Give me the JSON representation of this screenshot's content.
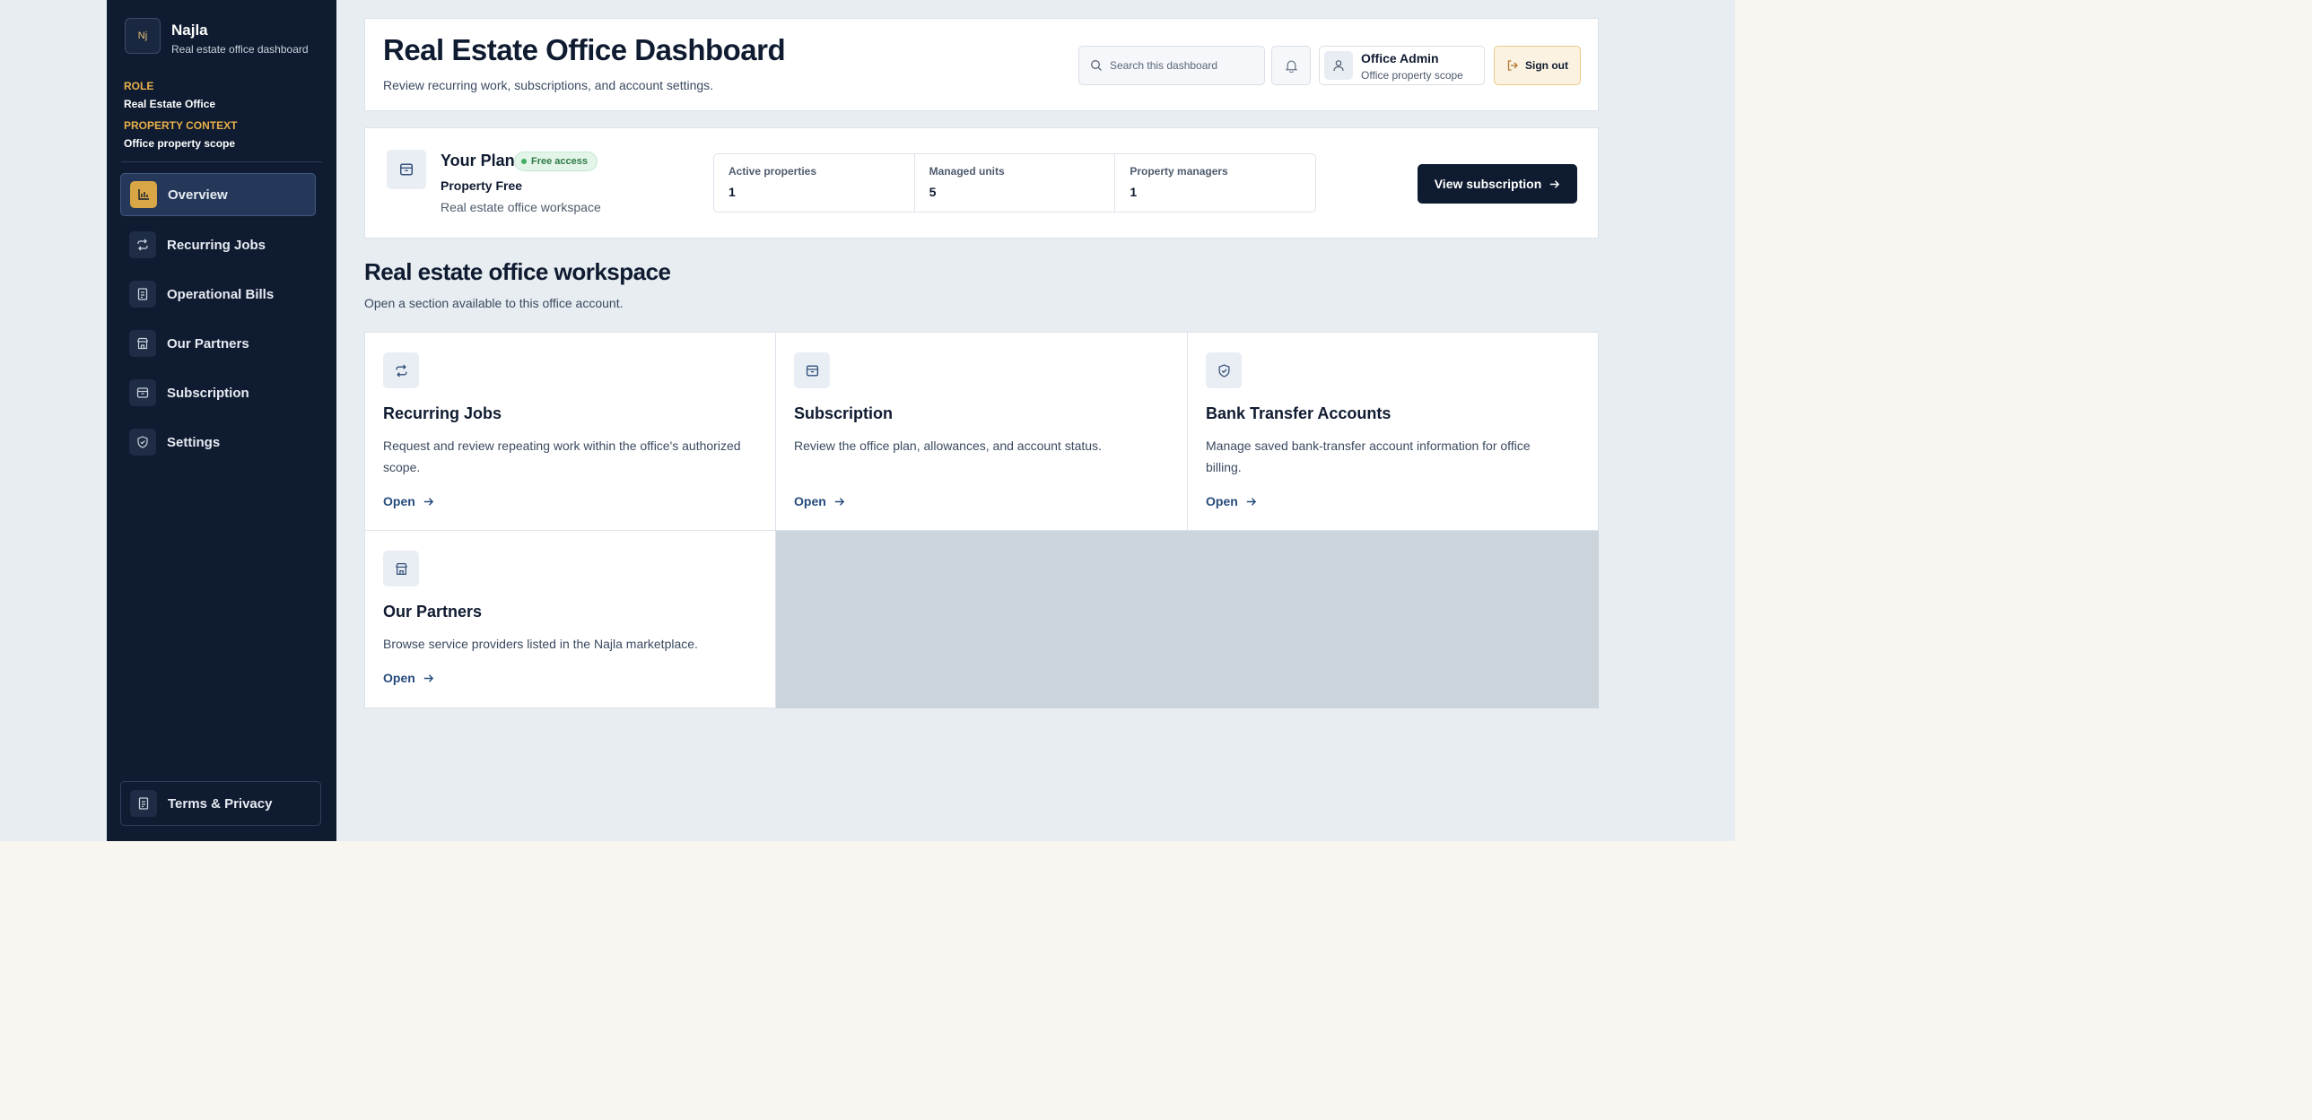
{
  "brand": {
    "name": "Najla",
    "subtitle": "Real estate office dashboard",
    "logo_text": "Nj"
  },
  "context": {
    "role_label": "ROLE",
    "role_value": "Real Estate Office",
    "property_label": "PROPERTY CONTEXT",
    "property_value": "Office property scope"
  },
  "sidebar": {
    "items": [
      {
        "label": "Overview",
        "icon": "chart-icon",
        "active": true
      },
      {
        "label": "Recurring Jobs",
        "icon": "repeat-icon"
      },
      {
        "label": "Operational Bills",
        "icon": "document-icon"
      },
      {
        "label": "Our Partners",
        "icon": "store-icon"
      },
      {
        "label": "Subscription",
        "icon": "archive-icon"
      },
      {
        "label": "Settings",
        "icon": "shield-icon"
      }
    ],
    "terms": "Terms & Privacy"
  },
  "header": {
    "title": "Real Estate Office Dashboard",
    "subtitle": "Review recurring work, subscriptions, and account settings.",
    "search_placeholder": "Search this dashboard",
    "user_name": "Office Admin",
    "user_scope": "Office property scope",
    "sign_out": "Sign out"
  },
  "plan": {
    "title": "Your Plan",
    "badge": "Free access",
    "name": "Property Free",
    "description": "Real estate office workspace",
    "stats": [
      {
        "label": "Active properties",
        "value": "1"
      },
      {
        "label": "Managed units",
        "value": "5"
      },
      {
        "label": "Property managers",
        "value": "1"
      }
    ],
    "button": "View subscription"
  },
  "workspace": {
    "title": "Real estate office workspace",
    "subtitle": "Open a section available to this office account.",
    "open_label": "Open",
    "cards": [
      {
        "title": "Recurring Jobs",
        "description": "Request and review repeating work within the office's authorized scope.",
        "icon": "repeat-icon"
      },
      {
        "title": "Subscription",
        "description": "Review the office plan, allowances, and account status.",
        "icon": "archive-icon"
      },
      {
        "title": "Bank Transfer Accounts",
        "description": "Manage saved bank-transfer account information for office billing.",
        "icon": "shield-icon"
      },
      {
        "title": "Our Partners",
        "description": "Browse service providers listed in the Najla marketplace.",
        "icon": "store-icon"
      }
    ]
  },
  "colors": {
    "sidebar_bg": "#0f1b30",
    "accent": "#d9a646",
    "page_bg": "#e7edf1",
    "link": "#264b7c"
  }
}
